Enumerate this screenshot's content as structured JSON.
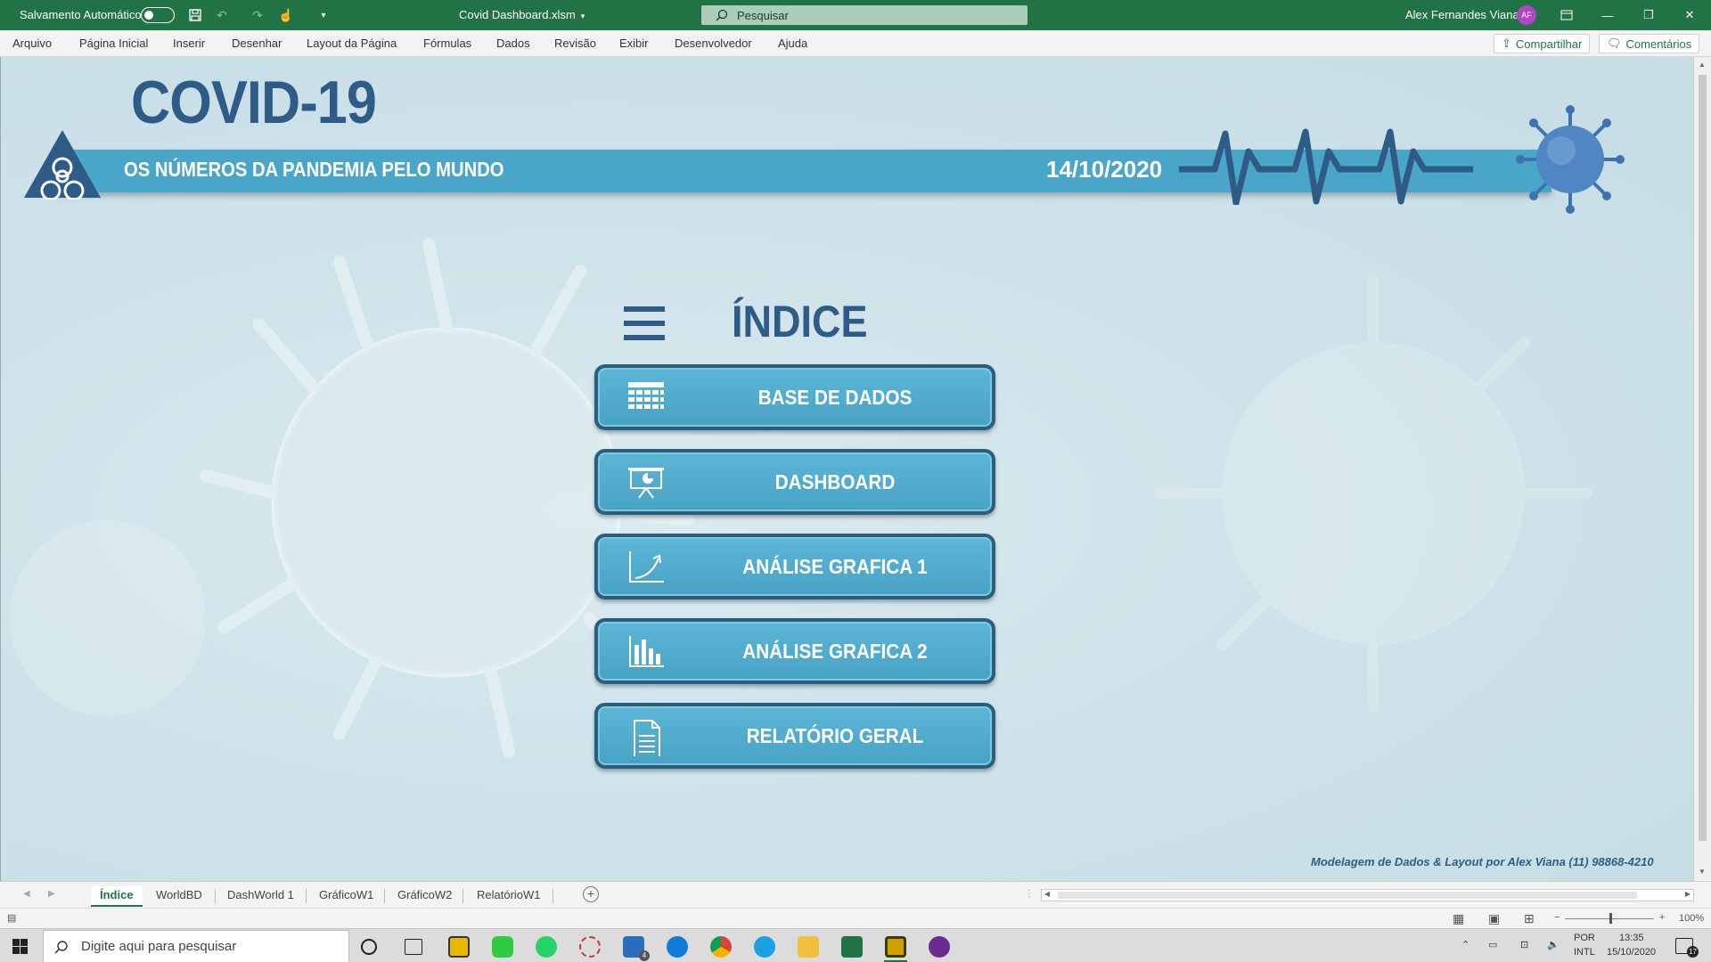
{
  "titlebar": {
    "autosave_label": "Salvamento Automático",
    "doc_title": "Covid Dashboard.xlsm",
    "search_placeholder": "Pesquisar",
    "user_name": "Alex Fernandes Viana",
    "user_initials": "AF"
  },
  "ribbon": {
    "tabs": [
      "Arquivo",
      "Página Inicial",
      "Inserir",
      "Desenhar",
      "Layout da Página",
      "Fórmulas",
      "Dados",
      "Revisão",
      "Exibir",
      "Desenvolvedor",
      "Ajuda"
    ],
    "share_label": "Compartilhar",
    "comments_label": "Comentários"
  },
  "header": {
    "title": "COVID-19",
    "subtitle": "OS NÚMEROS DA PANDEMIA PELO MUNDO",
    "date": "14/10/2020"
  },
  "index": {
    "title": "ÍNDICE",
    "buttons": [
      {
        "label": "BASE DE DADOS",
        "icon": "calendar-grid-icon"
      },
      {
        "label": "DASHBOARD",
        "icon": "presentation-board-icon"
      },
      {
        "label": "ANÁLISE GRAFICA 1",
        "icon": "growth-chart-icon"
      },
      {
        "label": "ANÁLISE GRAFICA 2",
        "icon": "bar-chart-icon"
      },
      {
        "label": "RELATÓRIO GERAL",
        "icon": "document-icon"
      }
    ]
  },
  "credit": "Modelagem de Dados & Layout por Alex Viana (11) 98868-4210",
  "sheets": {
    "tabs": [
      "Índice",
      "WorldBD",
      "DashWorld 1",
      "GráficoW1",
      "GráficoW2",
      "RelatórioW1"
    ],
    "active": "Índice"
  },
  "statusbar": {
    "zoom": "100%"
  },
  "taskbar": {
    "search_placeholder": "Digite aqui para pesquisar",
    "lang": "POR",
    "layout": "INTL",
    "time": "13:35",
    "date": "15/10/2020",
    "mail_badge": "4",
    "notifications": "17"
  },
  "colors": {
    "excel_green": "#217346",
    "banner_blue": "#4aa6c8",
    "title_navy": "#2e5c87",
    "button_fill": "#52abcd"
  }
}
